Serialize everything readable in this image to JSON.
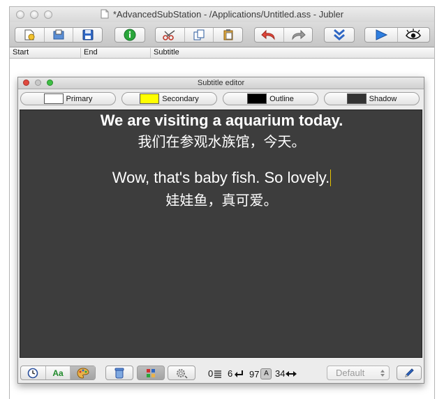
{
  "window": {
    "title": "*AdvancedSubStation - /Applications/Untitled.ass - Jubler"
  },
  "table": {
    "columns": [
      "Start",
      "End",
      "Subtitle"
    ]
  },
  "toolbar": {
    "groups": [
      [
        "new-file-icon",
        "open-file-icon",
        "save-icon"
      ],
      [
        "info-icon"
      ],
      [
        "cut-icon",
        "copy-icon",
        "paste-icon"
      ],
      [
        "undo-icon",
        "redo-icon"
      ],
      [
        "sort-down-icon"
      ],
      [
        "play-icon",
        "preview-eye-icon"
      ]
    ]
  },
  "editor": {
    "title": "Subtitle editor",
    "styles": [
      {
        "label": "Primary",
        "color": "#ffffff"
      },
      {
        "label": "Secondary",
        "color": "#ffff00"
      },
      {
        "label": "Outline",
        "color": "#000000"
      },
      {
        "label": "Shadow",
        "color": "#333333"
      }
    ],
    "text_lines": [
      "We are visiting a aquarium today.",
      "我们在参观水族馆，今天。",
      "",
      "Wow, that's baby fish. So lovely.",
      "娃娃鱼，真可爱。"
    ],
    "stats": {
      "lines": "0",
      "newlines": "6",
      "chars": "97",
      "width": "34"
    },
    "style_select": {
      "value": "Default"
    }
  }
}
